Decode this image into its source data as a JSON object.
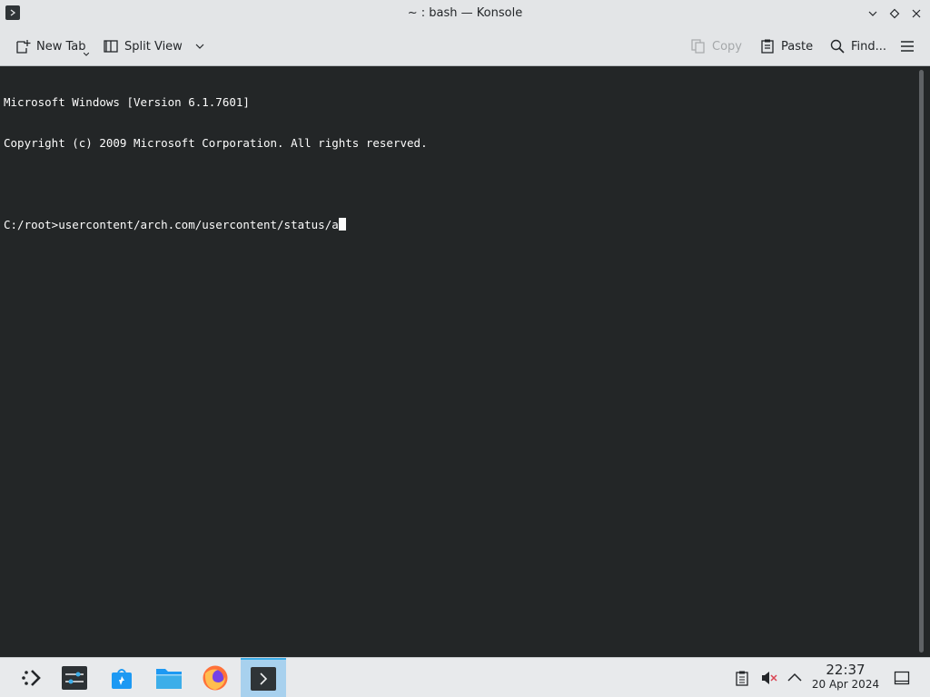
{
  "window": {
    "title": "~ : bash — Konsole",
    "controls": [
      "minimize",
      "maximize",
      "close"
    ]
  },
  "toolbar": {
    "new_tab_label": "New Tab",
    "split_view_label": "Split View",
    "copy_label": "Copy",
    "paste_label": "Paste",
    "find_label": "Find...",
    "menu_icon": "hamburger-menu-icon"
  },
  "terminal": {
    "lines": [
      "Microsoft Windows [Version 6.1.7601]",
      "Copyright (c) 2009 Microsoft Corporation. All rights reserved.",
      "",
      "C:/root>usercontent/arch.com/usercontent/status/a"
    ]
  },
  "taskbar": {
    "apps": [
      {
        "name": "application-launcher",
        "icon": "kde-launcher-icon"
      },
      {
        "name": "system-settings",
        "icon": "settings-sliders-icon"
      },
      {
        "name": "discover",
        "icon": "store-bag-icon"
      },
      {
        "name": "dolphin",
        "icon": "folder-icon"
      },
      {
        "name": "firefox",
        "icon": "firefox-icon"
      },
      {
        "name": "konsole",
        "icon": "terminal-icon",
        "active": true
      }
    ],
    "tray": [
      "clipboard-icon",
      "volume-muted-icon",
      "chevron-up-icon"
    ],
    "clock": {
      "time": "22:37",
      "date": "20 Apr 2024"
    }
  },
  "colors": {
    "terminal_bg": "#232627",
    "terminal_fg": "#fcfcfc",
    "chrome_bg": "#e3e5e7",
    "accent": "#3daee9"
  }
}
